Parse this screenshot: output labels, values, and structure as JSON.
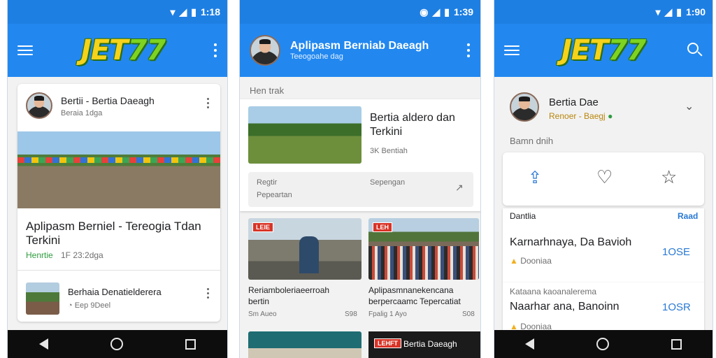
{
  "brand": {
    "logo_main": "JET",
    "logo_accent": "77"
  },
  "colors": {
    "appbar": "#2288f0",
    "statusbar": "#1e7fe3",
    "accent": "#2a79d4",
    "green": "#2f9b3e",
    "navbar": "#0d0d0d"
  },
  "screen1": {
    "status_time": "1:18",
    "post_card": {
      "author": "Bertii - Bertia Daeagh",
      "meta": "Beraia 1dga"
    },
    "headline": {
      "line1": "Aplipasm Berniel - Tereogia Tdan",
      "line2": "Terkini"
    },
    "headline_meta": {
      "source": "Henrtie",
      "time": "1F 23:2dga"
    },
    "list_item": {
      "title": "Berhaia Denatielderera",
      "meta": "Eep 9Deel"
    }
  },
  "screen2": {
    "status_time": "1:39",
    "header": {
      "title": "Aplipasm Berniab Daeagh",
      "subtitle": "Teeogoahe dag"
    },
    "section_label": "Hen trak",
    "feature": {
      "title_line1": "Bertia aldero dan",
      "title_line2": "Terkini",
      "meta": "3K Bentiah"
    },
    "info_box": {
      "label1": "Regtir",
      "value1": "Pepeartan",
      "label2": "Sepengan"
    },
    "grid": [
      {
        "tag": "LEIE",
        "title_line1": "Reriamboleriaeerroah",
        "title_line2": "bertin",
        "meta_left": "Sm Aueo",
        "meta_right": "S98"
      },
      {
        "tag": "LEH",
        "title_line1": "Aplipasmnanekencana",
        "title_line2": "berpercaamc Tepercatiat",
        "meta_left": "Fpalig 1 Ayo",
        "meta_right": "S08"
      }
    ],
    "bottom_tag": "LEHFT",
    "bottom_title": "Bertia Daeagh"
  },
  "screen3": {
    "status_time": "1:90",
    "profile": {
      "name": "Bertia Dae",
      "handle": "Renoer - Baegj"
    },
    "section_label": "Bamn dnih",
    "actions": {
      "share": "share-icon",
      "like": "heart-icon",
      "favorite": "star-icon"
    },
    "row_header": {
      "left": "Dantlia",
      "right": "Raad"
    },
    "items": [
      {
        "title": "Karnarhnaya, Da Bavioh",
        "meta": "Dooniaa",
        "value": "1OSE"
      },
      {
        "overline": "Kataana kaoanalerema",
        "title": "Naarhar ana, Banoinn",
        "meta": "Dooniaa",
        "value": "1OSR"
      }
    ]
  }
}
